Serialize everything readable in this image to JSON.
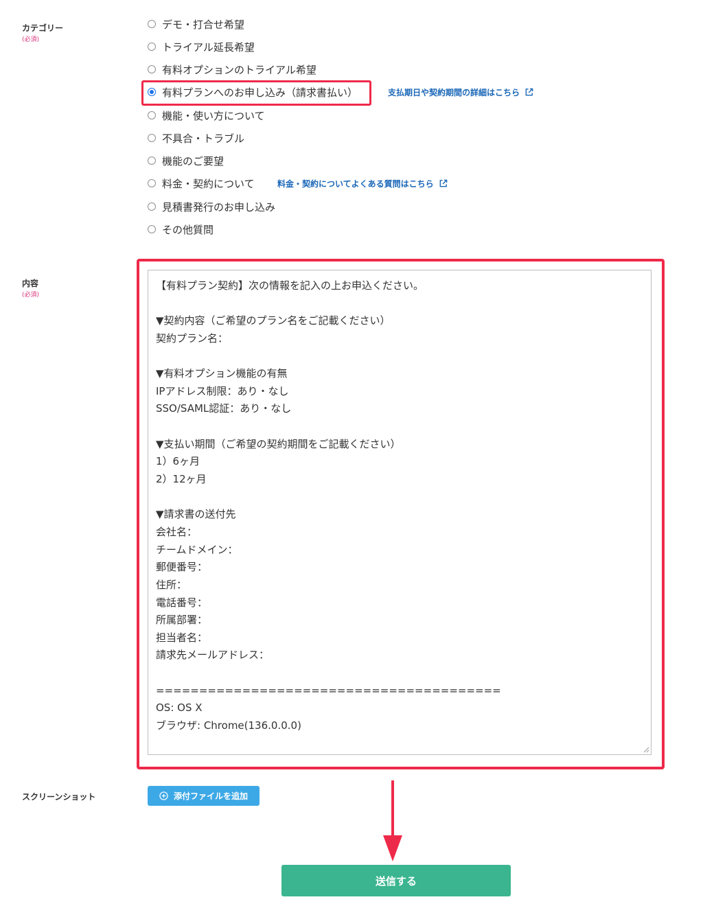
{
  "category": {
    "label": "カテゴリー",
    "required": "(必須)",
    "options": [
      {
        "label": "デモ・打合せ希望",
        "checked": false
      },
      {
        "label": "トライアル延長希望",
        "checked": false
      },
      {
        "label": "有料オプションのトライアル希望",
        "checked": false
      },
      {
        "label": "有料プランへのお申し込み（請求書払い）",
        "checked": true
      },
      {
        "label": "機能・使い方について",
        "checked": false
      },
      {
        "label": "不具合・トラブル",
        "checked": false
      },
      {
        "label": "機能のご要望",
        "checked": false
      },
      {
        "label": "料金・契約について",
        "checked": false
      },
      {
        "label": "見積書発行のお申し込み",
        "checked": false
      },
      {
        "label": "その他質問",
        "checked": false
      }
    ],
    "links": {
      "payment_details": "支払期日や契約期間の詳細はこちら",
      "pricing_faq": "料金・契約についてよくある質問はこちら"
    }
  },
  "content": {
    "label": "内容",
    "required": "(必須)",
    "lines": [
      "【有料プラン契約】次の情報を記入の上お申込ください。",
      "",
      "▼契約内容（ご希望のプラン名をご記載ください）",
      "契約プラン名：",
      "",
      "▼有料オプション機能の有無",
      "IPアドレス制限：あり・なし",
      "SSO/SAML認証：あり・なし",
      "",
      "▼支払い期間（ご希望の契約期間をご記載ください）",
      "1）6ヶ月",
      "2）12ヶ月",
      "",
      "▼請求書の送付先",
      "会社名：",
      "チームドメイン：",
      "郵便番号：",
      "住所：",
      "電話番号：",
      "所属部署：",
      "担当者名：",
      "請求先メールアドレス：",
      "",
      "========================================",
      "OS: OS X",
      "ブラウザ: Chrome(136.0.0.0)"
    ]
  },
  "screenshot": {
    "label": "スクリーンショット",
    "add_button": "添付ファイルを追加"
  },
  "submit": {
    "label": "送信する"
  },
  "colors": {
    "highlight": "#ee2a4a",
    "link": "#1a67b8",
    "attach_button": "#3da8e6",
    "submit_button": "#3ab58f",
    "required": "#d6337b"
  }
}
